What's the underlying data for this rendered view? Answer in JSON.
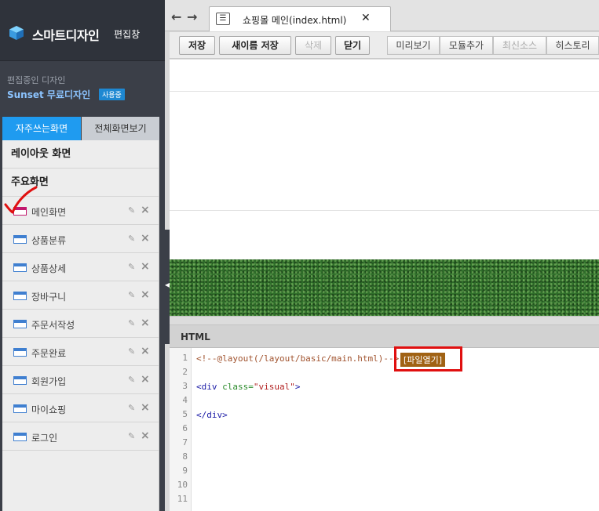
{
  "brand": {
    "title": "스마트디자인",
    "subtitle": "편집창"
  },
  "design": {
    "label": "편집중인 디자인",
    "name": "Sunset 무료디자인",
    "status_badge": "사용중"
  },
  "sidebar_tabs": [
    {
      "label": "자주쓰는화면",
      "active": true
    },
    {
      "label": "전체화면보기",
      "active": false
    }
  ],
  "sections": {
    "layout": "레이아웃 화면",
    "main": "주요화면"
  },
  "pages": [
    {
      "label": "메인화면",
      "icon": "main-page-icon"
    },
    {
      "label": "상품분류",
      "icon": "page-icon"
    },
    {
      "label": "상품상세",
      "icon": "page-icon"
    },
    {
      "label": "장바구니",
      "icon": "page-icon"
    },
    {
      "label": "주문서작성",
      "icon": "page-icon"
    },
    {
      "label": "주문완료",
      "icon": "page-icon"
    },
    {
      "label": "회원가입",
      "icon": "page-icon"
    },
    {
      "label": "마이쇼핑",
      "icon": "page-icon"
    },
    {
      "label": "로그인",
      "icon": "page-icon"
    }
  ],
  "file_tab": {
    "title": "쇼핑몰 메인(index.html)"
  },
  "toolbar": {
    "save": "저장",
    "save_as": "새이름 저장",
    "delete": "삭제",
    "close": "닫기",
    "preview": "미리보기",
    "add_module": "모듈추가",
    "latest_source": "최신소스",
    "history": "히스토리"
  },
  "code_panel": {
    "title": "HTML",
    "line_numbers": [
      "1",
      "2",
      "3",
      "4",
      "5",
      "6",
      "7",
      "8",
      "9",
      "10",
      "11"
    ],
    "line1_comment": "<!--@layout(/layout/basic/main.html)-->",
    "open_file": "[파일열기]",
    "line3_open": "<div",
    "line3_attr": "class=",
    "line3_value": "\"visual\"",
    "line3_close": ">",
    "line5": "</div>"
  },
  "colors": {
    "accent": "#1f9bf0",
    "sidebar_bg": "#3b3f48",
    "highlight": "#e01010",
    "check": "#e01010"
  }
}
